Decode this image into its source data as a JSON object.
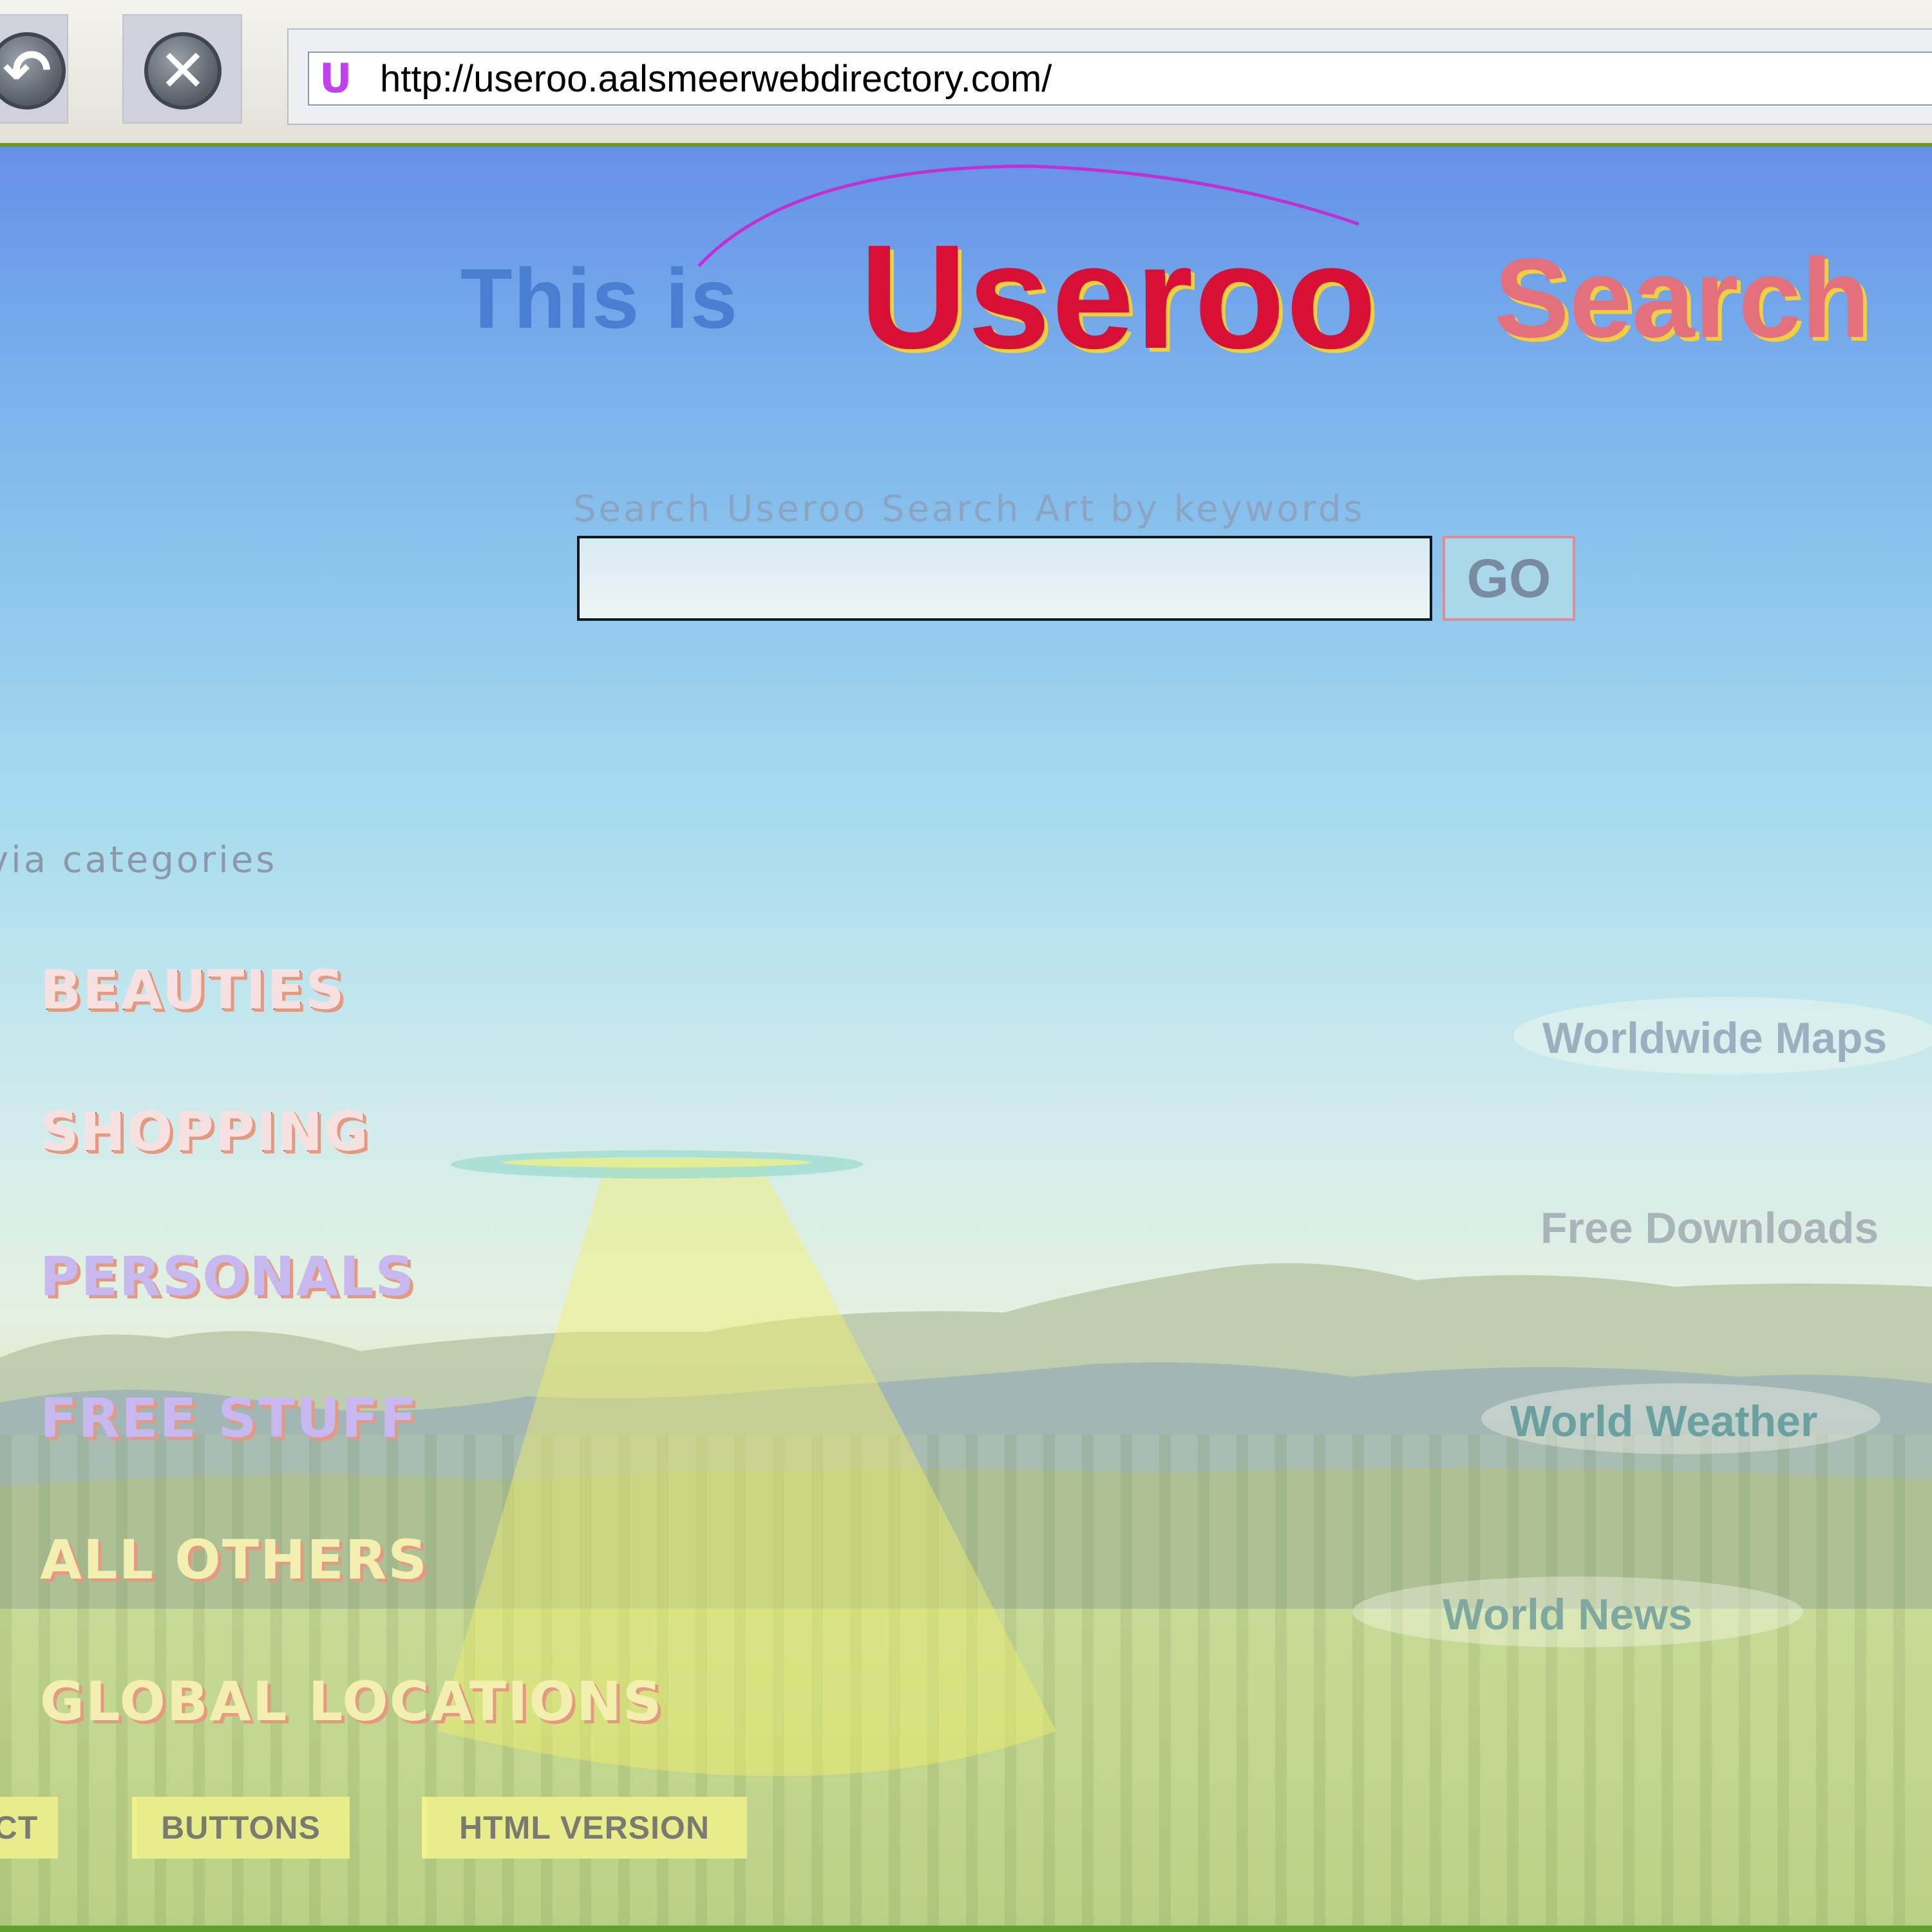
{
  "browser": {
    "back_icon": "back-arrow-icon",
    "stop_icon": "stop-x-icon",
    "url": "http://useroo.aalsmeerwebdirectory.com/",
    "favicon_letter": "U"
  },
  "header": {
    "this_is": "This is",
    "brand": "Useroo",
    "search_word": "Search"
  },
  "search": {
    "label": "Search Useroo Search Art by keywords",
    "input_value": "",
    "go_label": "GO"
  },
  "categories": {
    "heading": "via categories",
    "items": [
      "BEAUTIES",
      "SHOPPING",
      "PERSONALS",
      "FREE STUFF",
      "ALL OTHERS",
      "GLOBAL LOCATIONS"
    ]
  },
  "right_links": [
    "Worldwide Maps",
    "Free Downloads",
    "World Weather",
    "World News"
  ],
  "bottom_buttons": [
    "CT",
    "BUTTONS",
    "HTML VERSION"
  ],
  "colors": {
    "brand": "#d81036",
    "brand_shadow": "#f0d040",
    "sky_top": "#6590e8",
    "grass": "#b6cf80"
  }
}
